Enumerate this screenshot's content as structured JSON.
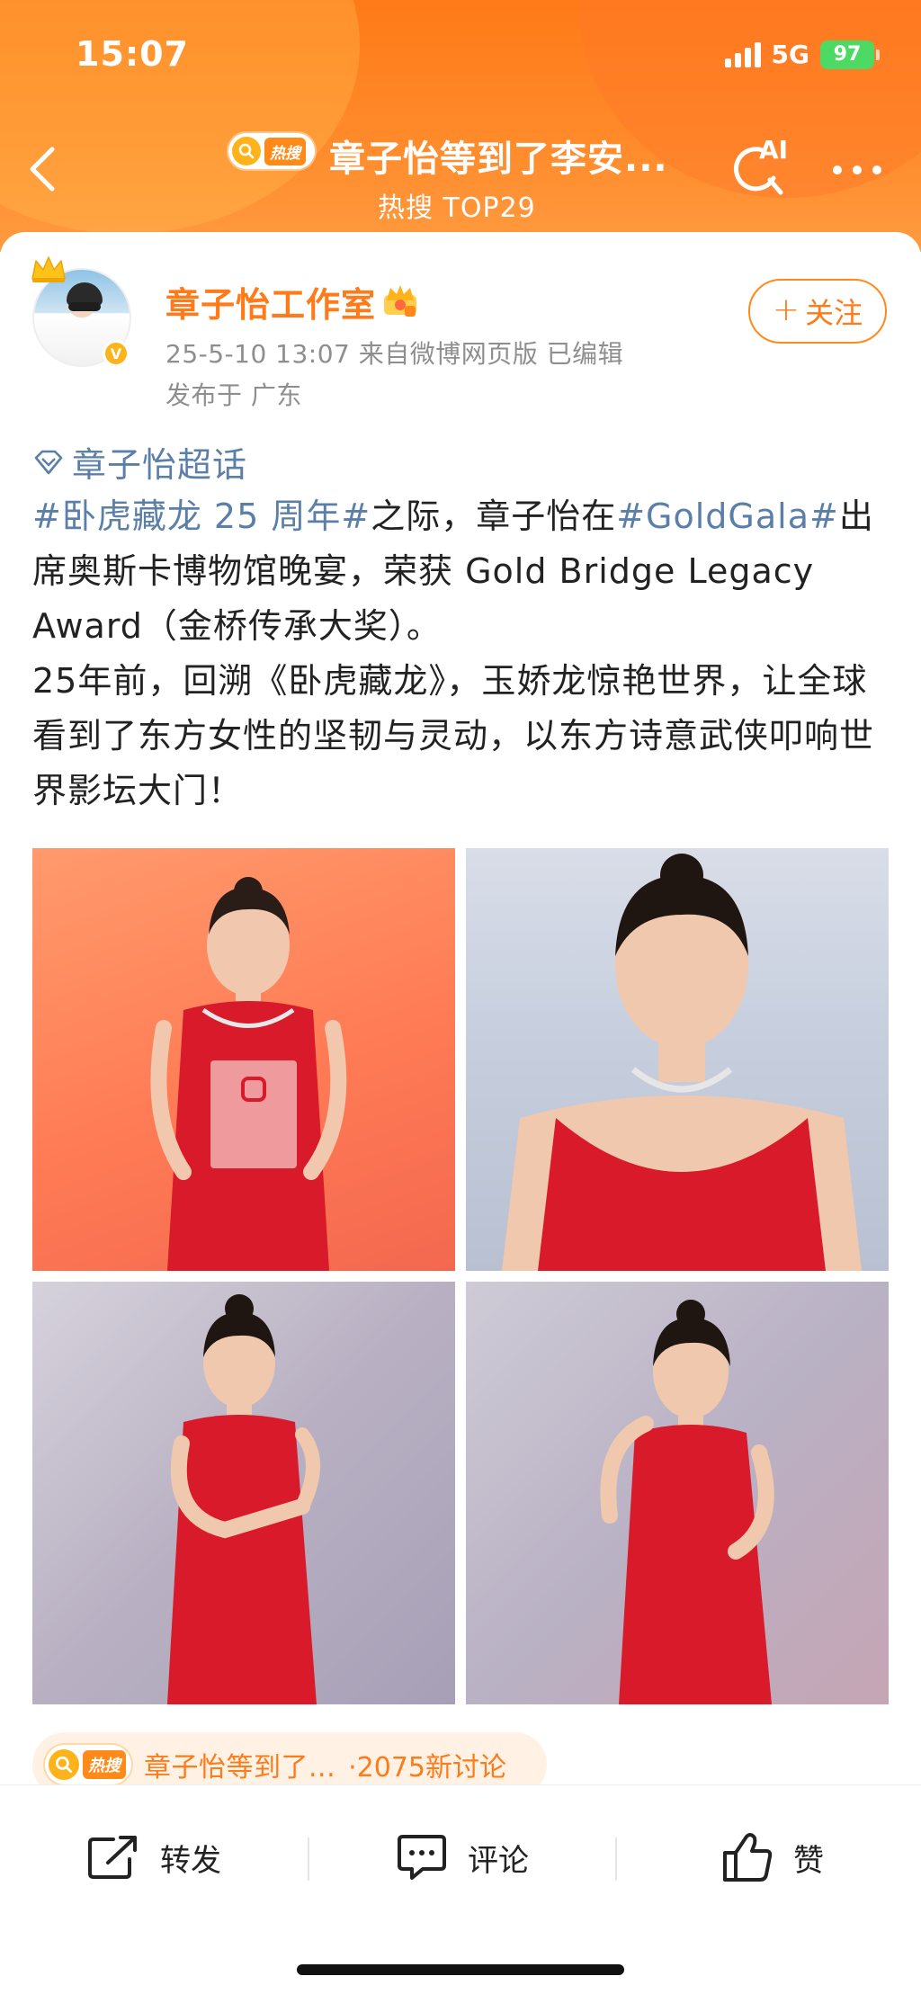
{
  "status_bar": {
    "time": "15:07",
    "network": "5G",
    "battery": "97"
  },
  "nav": {
    "hot_pill_label": "热搜",
    "title": "章子怡等到了李安...",
    "subtitle": "热搜 TOP29",
    "ai_label": "AI"
  },
  "post": {
    "author": "章子怡工作室",
    "meta_line": "25-5-10 13:07  来自微博网页版  已编辑",
    "location": "发布于 广东",
    "follow_label": "关注",
    "supertopic": "章子怡超话",
    "text": {
      "tag1": "#卧虎藏龙 25 周年#",
      "seg1": "之际，章子怡在",
      "tag2": "#GoldGala#",
      "seg2": "出席奥斯卡博物馆晚宴，荣获 Gold Bridge Legacy Award（金桥传承大奖）。",
      "para2": "25年前，回溯《卧虎藏龙》，玉娇龙惊艳世界，让全球看到了东方女性的坚韧与灵动，以东方诗意武侠叩响世界影坛大门！"
    }
  },
  "hot_topic": {
    "pill_label": "热搜",
    "text": "章子怡等到了...",
    "count": "·2075新讨论"
  },
  "actions": {
    "repost": "转发",
    "comment": "评论",
    "like": "赞"
  },
  "colors": {
    "brand_orange": "#ff7a18",
    "link_blue": "#5b7fa8",
    "meta_gray": "#8e8e8e",
    "dress_red": "#e01b2a"
  }
}
